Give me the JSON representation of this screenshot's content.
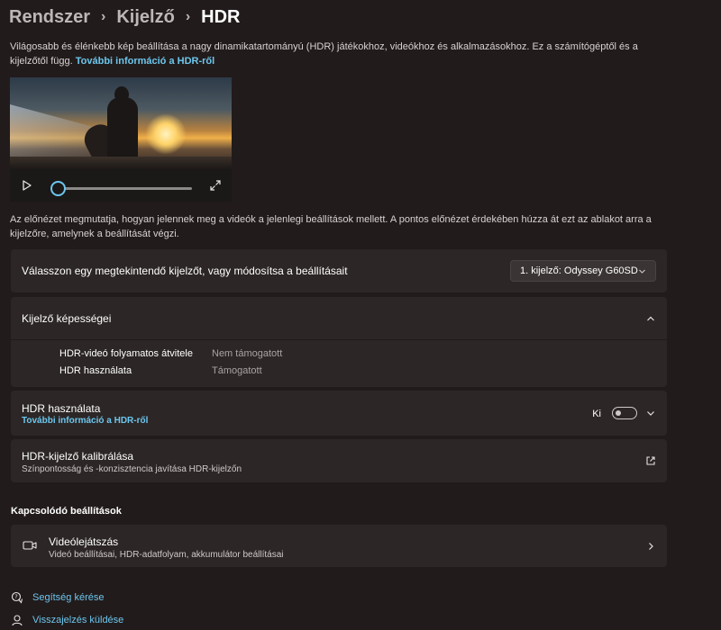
{
  "breadcrumb": {
    "items": [
      "Rendszer",
      "Kijelző"
    ],
    "separator": "›",
    "current": "HDR"
  },
  "intro": {
    "text": "Világosabb és élénkebb kép beállítása a nagy dinamikatartományú (HDR) játékokhoz, videókhoz és alkalmazásokhoz. Ez a számítógéptől és a kijelzőtől függ. ",
    "link": "További információ a HDR-ről"
  },
  "preview": {
    "icons": {
      "play": "play-icon",
      "fullscreen": "fullscreen-icon"
    },
    "progress_fraction": 0.0
  },
  "preview_note": "Az előnézet megmutatja, hogyan jelennek meg a videók a jelenlegi beállítások mellett. A pontos előnézet érdekében húzza át ezt az ablakot arra a kijelzőre, amelynek a beállítását végzi.",
  "display_select": {
    "label": "Válasszon egy megtekintendő kijelzőt, vagy módosítsa a beállításait",
    "value": "1. kijelző: Odyssey G60SD"
  },
  "capabilities": {
    "title": "Kijelző képességei",
    "rows": [
      {
        "key": "HDR-videó folyamatos átvitele",
        "value": "Nem támogatott"
      },
      {
        "key": "HDR használata",
        "value": "Támogatott"
      }
    ]
  },
  "use_hdr": {
    "title": "HDR használata",
    "link": "További információ a HDR-ről",
    "state_label": "Ki",
    "on": false
  },
  "calibration": {
    "title": "HDR-kijelző kalibrálása",
    "subtitle": "Színpontosság és -konzisztencia javítása HDR-kijelzőn"
  },
  "related": {
    "heading": "Kapcsolódó beállítások",
    "items": [
      {
        "title": "Videólejátszás",
        "subtitle": "Videó beállításai, HDR-adatfolyam, akkumulátor beállításai",
        "icon": "video-icon"
      }
    ]
  },
  "footer": {
    "help": "Segítség kérése",
    "feedback": "Visszajelzés küldése"
  },
  "colors": {
    "background": "#221b1b",
    "card": "#2c2626",
    "accent": "#6cc7ee"
  }
}
